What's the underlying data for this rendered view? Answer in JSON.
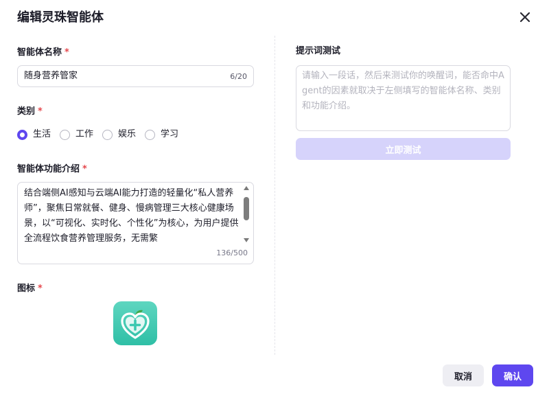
{
  "dialog": {
    "title": "编辑灵珠智能体",
    "close_icon": "close-icon"
  },
  "form": {
    "required_mark": "*",
    "name": {
      "label": "智能体名称",
      "value": "随身营养管家",
      "count": "6/20"
    },
    "category": {
      "label": "类别",
      "options": [
        {
          "label": "生活",
          "checked": true
        },
        {
          "label": "工作",
          "checked": false
        },
        {
          "label": "娱乐",
          "checked": false
        },
        {
          "label": "学习",
          "checked": false
        }
      ]
    },
    "description": {
      "label": "智能体功能介绍",
      "value": "结合端侧AI感知与云端AI能力打造的轻量化“私人营养师”，聚焦日常就餐、健身、慢病管理三大核心健康场景，以“可视化、实时化、个性化”为核心，为用户提供全流程饮食营养管理服务，无需繁",
      "count": "136/500"
    },
    "icon": {
      "label": "图标",
      "image": "heart-plus-icon",
      "colors": {
        "tile": "#3cc8b0",
        "leaf": "#3fa84a"
      }
    }
  },
  "prompt_test": {
    "label": "提示词测试",
    "placeholder": "请输入一段话，然后来测试你的唤醒词，能否命中Agent的因素就取决于左侧填写的智能体名称、类别和功能介绍。",
    "button_label": "立即测试"
  },
  "footer": {
    "cancel_label": "取消",
    "confirm_label": "确认"
  },
  "colors": {
    "accent": "#5e47ef",
    "accent_disabled": "#d6d3fb",
    "required": "#e5484d"
  }
}
